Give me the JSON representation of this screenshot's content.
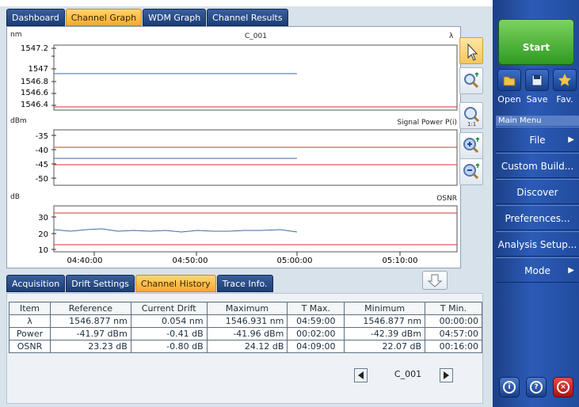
{
  "tabs_top": [
    "Dashboard",
    "Channel Graph",
    "WDM Graph",
    "Channel Results"
  ],
  "tabs_top_active": "Channel Graph",
  "tabs_bottom": [
    "Acquisition",
    "Drift Settings",
    "Channel History",
    "Trace Info."
  ],
  "tabs_bottom_active": "Channel History",
  "channel_name": "C_001",
  "graph": {
    "x_ticks": [
      "04:40:00",
      "04:50:00",
      "05:00:00",
      "05:10:00"
    ],
    "wavelength": {
      "unit": "nm",
      "label": "λ",
      "ticks": [
        "1547.2",
        "1547",
        "1546.8",
        "1546.6",
        "1546.4"
      ]
    },
    "power": {
      "unit": "dBm",
      "label": "Signal Power P(i)",
      "ticks": [
        "-35",
        "-40",
        "-45",
        "-50"
      ]
    },
    "osnr": {
      "unit": "dB",
      "label": "OSNR",
      "ticks": [
        "30",
        "20",
        "10"
      ]
    }
  },
  "table": {
    "headers": [
      "Item",
      "Reference",
      "Current Drift",
      "Maximum",
      "T Max.",
      "Minimum",
      "T Min."
    ],
    "rows": [
      [
        "λ",
        "1546.877 nm",
        "0.054 nm",
        "1546.931 nm",
        "04:59:00",
        "1546.877 nm",
        "00:00:00"
      ],
      [
        "Power",
        "-41.97 dBm",
        "-0.41 dB",
        "-41.96 dBm",
        "00:02:00",
        "-42.39 dBm",
        "04:57:00"
      ],
      [
        "OSNR",
        "23.23 dB",
        "-0.80 dB",
        "24.12 dB",
        "04:09:00",
        "22.07 dB",
        "00:16:00"
      ]
    ]
  },
  "sidebar": {
    "start": "Start",
    "file_buttons": [
      "Open",
      "Save",
      "Fav."
    ],
    "main_menu_title": "Main Menu",
    "menu_items": [
      "File",
      "Custom Build...",
      "Discover",
      "Preferences...",
      "Analysis Setup...",
      "Mode"
    ]
  },
  "colors": {
    "trace": "#3a6ea5",
    "threshold": "#e03030",
    "accent_tab": "#f3a935",
    "start_green": "#2f9a23"
  },
  "icons": [
    "pointer-icon",
    "zoom-fit-icon",
    "zoom-1to1-icon",
    "zoom-in-icon",
    "zoom-out-icon",
    "expand-down-icon",
    "info-icon",
    "help-icon",
    "close-icon"
  ]
}
